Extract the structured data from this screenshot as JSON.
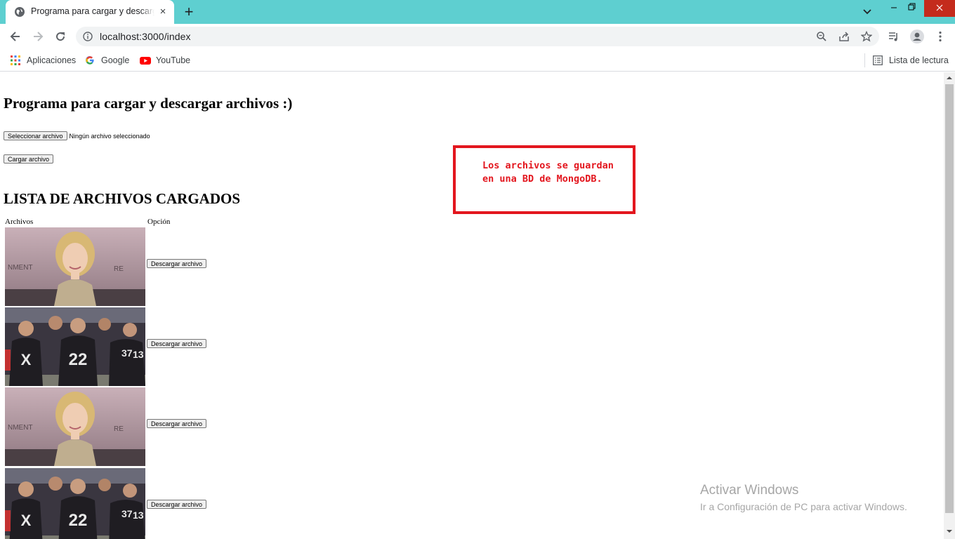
{
  "browser": {
    "tab_title": "Programa para cargar y descargar archivos",
    "url": "localhost:3000/index",
    "accent_color": "#5ecfd0",
    "bookmarks": [
      {
        "label": "Aplicaciones",
        "icon": "apps-grid-icon"
      },
      {
        "label": "Google",
        "icon": "google-icon"
      },
      {
        "label": "YouTube",
        "icon": "youtube-icon"
      }
    ],
    "reading_list": "Lista de lectura"
  },
  "page": {
    "title": "Programa para cargar y descargar archivos :)",
    "file_input_button": "Seleccionar archivo",
    "file_input_status": "Ningún archivo seleccionado",
    "upload_button": "Cargar archivo",
    "list_title": "LISTA DE ARCHIVOS CARGADOS",
    "table_headers": [
      "Archivos",
      "Opción"
    ],
    "files": [
      {
        "image": "portrait-photo",
        "action": "Descargar archivo"
      },
      {
        "image": "football-team-photo",
        "action": "Descargar archivo"
      },
      {
        "image": "portrait-photo",
        "action": "Descargar archivo"
      },
      {
        "image": "football-team-photo",
        "action": "Descargar archivo"
      }
    ]
  },
  "annotation": {
    "text": "Los archivos se guardan en una BD de MongoDB.",
    "color": "#e3161e"
  },
  "watermark": {
    "line1": "Activar Windows",
    "line2": "Ir a Configuración de PC para activar Windows."
  }
}
